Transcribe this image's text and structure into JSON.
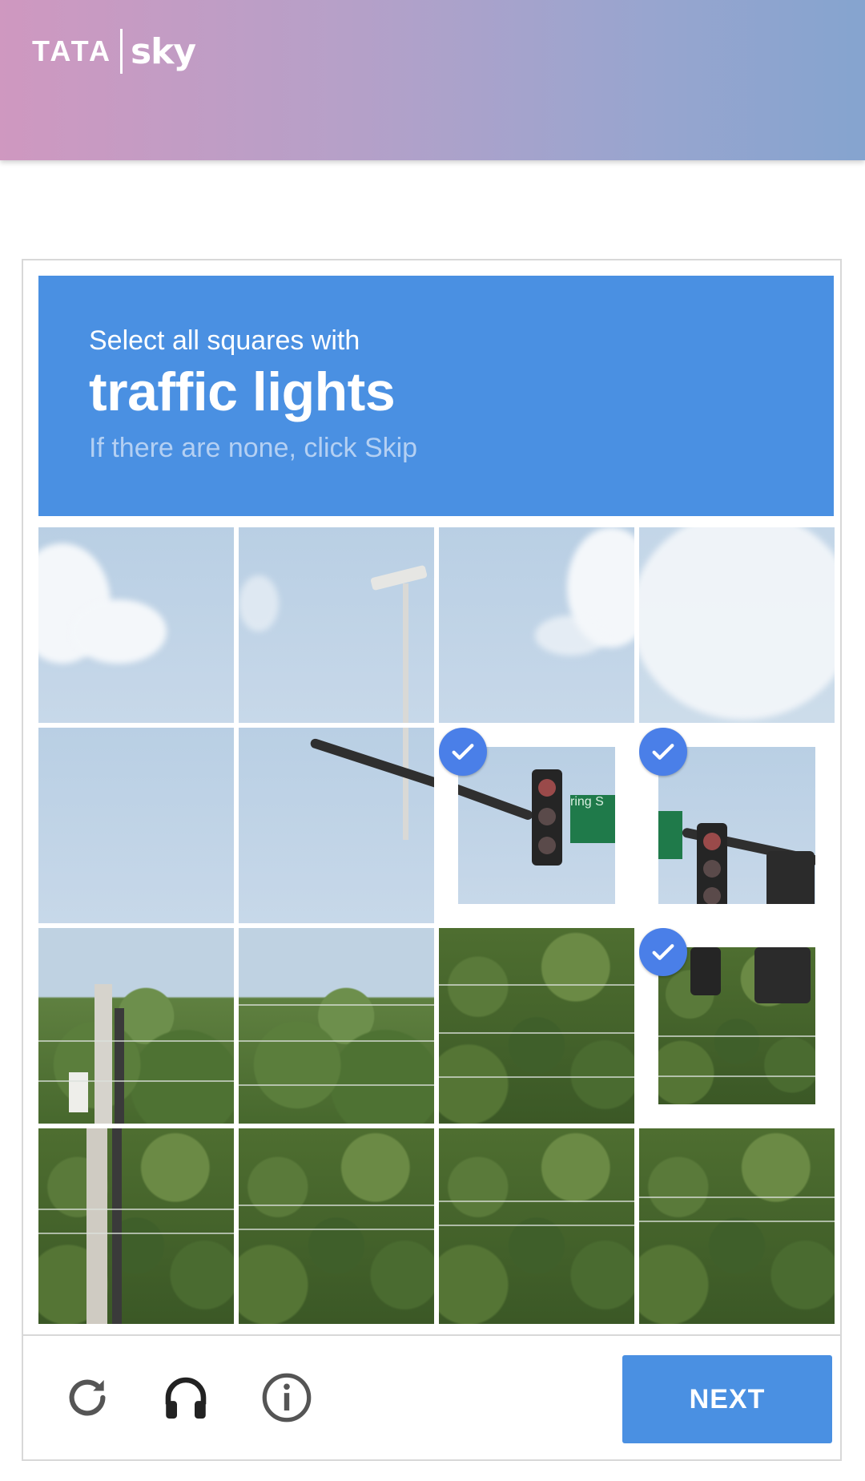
{
  "header": {
    "logo_left": "TATA",
    "logo_right": "sky"
  },
  "captcha": {
    "instruction_line": "Select all squares with",
    "target": "traffic lights",
    "hint": "If there are none, click Skip",
    "grid": {
      "rows": 4,
      "cols": 4,
      "selected_tiles": [
        {
          "row": 2,
          "col": 3
        },
        {
          "row": 2,
          "col": 4
        },
        {
          "row": 3,
          "col": 4
        }
      ]
    },
    "sign_text": "ring S",
    "footer": {
      "reload_icon": "reload-icon",
      "audio_icon": "headphones-icon",
      "info_icon": "info-icon",
      "next_label": "NEXT"
    }
  },
  "colors": {
    "accent": "#4a90e2",
    "check": "#4a7fe8",
    "header_left": "#cf98c0",
    "header_right": "#85a4cf"
  }
}
